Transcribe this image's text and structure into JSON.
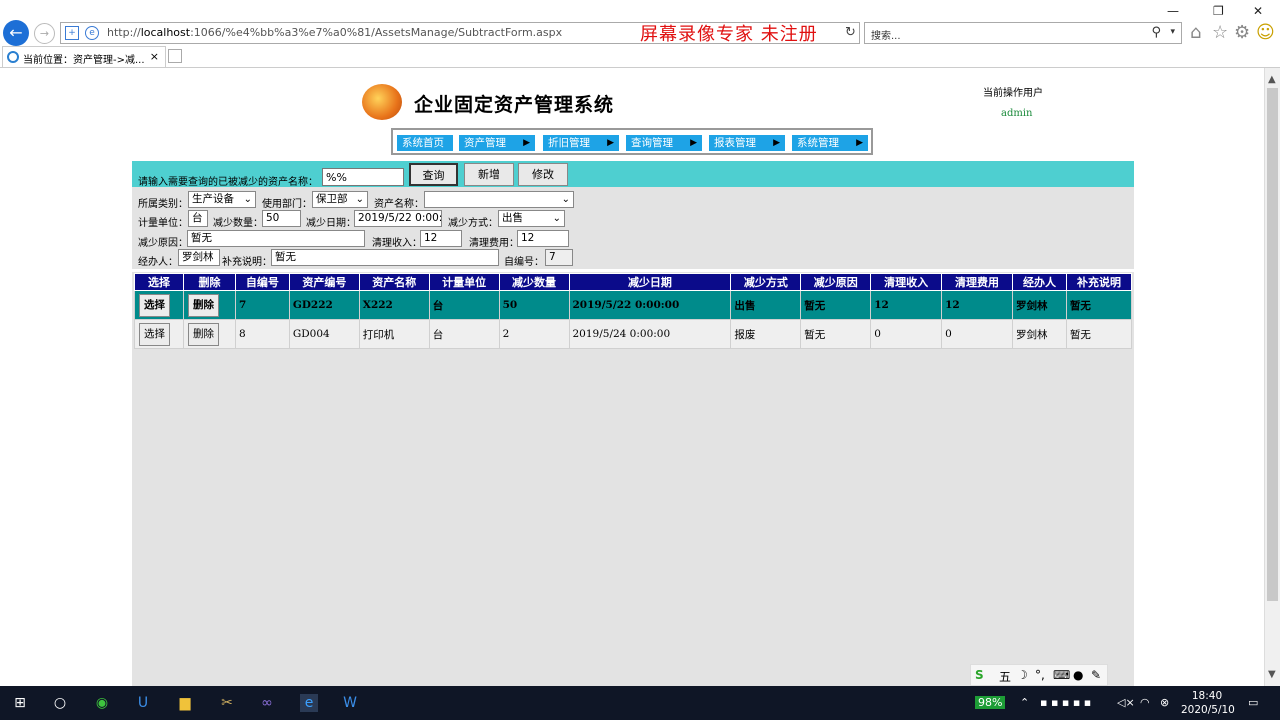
{
  "browser": {
    "url_prefix": "http://",
    "url_host": "localhost",
    "url_rest": ":1066/%e4%bb%a3%e7%a0%81/AssetsManage/SubtractForm.aspx",
    "watermark": "屏幕录像专家 未注册",
    "search_placeholder": "搜索...",
    "tab_title": "当前位置：资产管理->减...",
    "tab_close": "×"
  },
  "header": {
    "system_title": "企业固定资产管理系统",
    "user_label": "当前操作用户",
    "user_name": "admin"
  },
  "menu": [
    {
      "label": "系统首页",
      "arrow": ""
    },
    {
      "label": "资产管理",
      "arrow": "▶"
    },
    {
      "label": "折旧管理",
      "arrow": "▶"
    },
    {
      "label": "查询管理",
      "arrow": "▶"
    },
    {
      "label": "报表管理",
      "arrow": "▶"
    },
    {
      "label": "系统管理",
      "arrow": "▶"
    }
  ],
  "search": {
    "label": "请输入需要查询的已被减少的资产名称：",
    "value": "%%",
    "query_button": "查询",
    "add_button": "新增",
    "edit_button": "修改"
  },
  "form": {
    "category_label": "所属类别：",
    "category_value": "生产设备",
    "dept_label": "使用部门：",
    "dept_value": "保卫部",
    "asset_name_label": "资产名称：",
    "asset_name_value": "",
    "unit_label": "计量单位：",
    "unit_value": "台",
    "qty_label": "减少数量：",
    "qty_value": "50",
    "date_label": "减少日期：",
    "date_value": "2019/5/22 0:00:00",
    "method_label": "减少方式：",
    "method_value": "出售",
    "reason_label": "减少原因：",
    "reason_value": "暂无",
    "income_label": "清理收入：",
    "income_value": "12",
    "cost_label": "清理费用：",
    "cost_value": "12",
    "handler_label": "经办人：",
    "handler_value": "罗剑林",
    "note_label": "补充说明：",
    "note_value": "暂无",
    "id_label": "自编号：",
    "id_value": "7"
  },
  "table": {
    "headers": [
      "选择",
      "删除",
      "自编号",
      "资产编号",
      "资产名称",
      "计量单位",
      "减少数量",
      "减少日期",
      "减少方式",
      "减少原因",
      "清理收入",
      "清理费用",
      "经办人",
      "补充说明"
    ],
    "select_label": "选择",
    "delete_label": "删除",
    "rows": [
      {
        "id": "7",
        "code": "GD222",
        "name": "X222",
        "unit": "台",
        "qty": "50",
        "date": "2019/5/22 0:00:00",
        "method": "出售",
        "reason": "暂无",
        "income": "12",
        "cost": "12",
        "handler": "罗剑林",
        "note": "暂无"
      },
      {
        "id": "8",
        "code": "GD004",
        "name": "打印机",
        "unit": "台",
        "qty": "2",
        "date": "2019/5/24 0:00:00",
        "method": "报废",
        "reason": "暂无",
        "income": "0",
        "cost": "0",
        "handler": "罗剑林",
        "note": "暂无"
      }
    ]
  },
  "ime": {
    "mode": "五"
  },
  "taskbar": {
    "battery": "98%",
    "time": "18:40",
    "date": "2020/5/10"
  }
}
